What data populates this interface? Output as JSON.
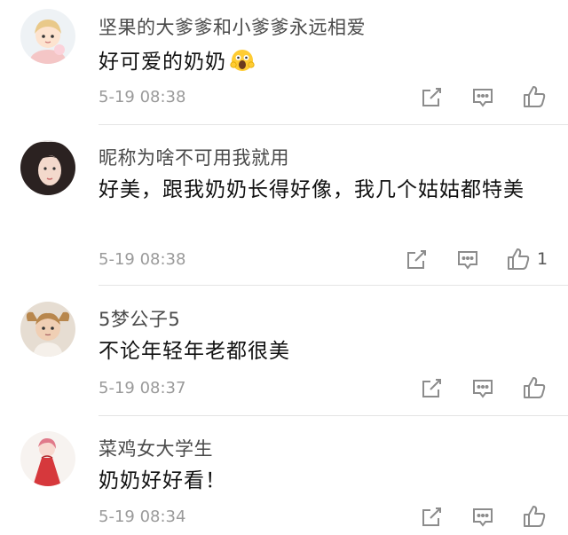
{
  "comments": [
    {
      "username": "坚果的大爹爹和小爹爹永远相爱",
      "content": "好可爱的奶奶",
      "emoji": "scream-face-emoji",
      "timestamp": "5-19 08:38",
      "like_count": "",
      "avatar": "cartoon-boy-avatar"
    },
    {
      "username": "昵称为啥不可用我就用",
      "content": "好美，跟我奶奶长得好像，我几个姑姑都特美",
      "timestamp": "5-19 08:38",
      "like_count": "1",
      "avatar": "woman-portrait-avatar"
    },
    {
      "username": "5梦公子5",
      "content": "不论年轻年老都很美",
      "timestamp": "5-19 08:37",
      "like_count": "",
      "avatar": "child-with-pigtails-avatar"
    },
    {
      "username": "菜鸡女大学生",
      "content": "奶奶好好看！",
      "timestamp": "5-19 08:34",
      "like_count": "",
      "avatar": "red-dress-illustration-avatar"
    }
  ],
  "icons": {
    "share": "share-icon",
    "reply": "comment-icon",
    "like": "thumbs-up-icon"
  },
  "colors": {
    "username": "#4a4a4a",
    "timestamp": "#9a9a9a",
    "icon": "#8c8c8c",
    "divider": "#e4e4e4"
  }
}
